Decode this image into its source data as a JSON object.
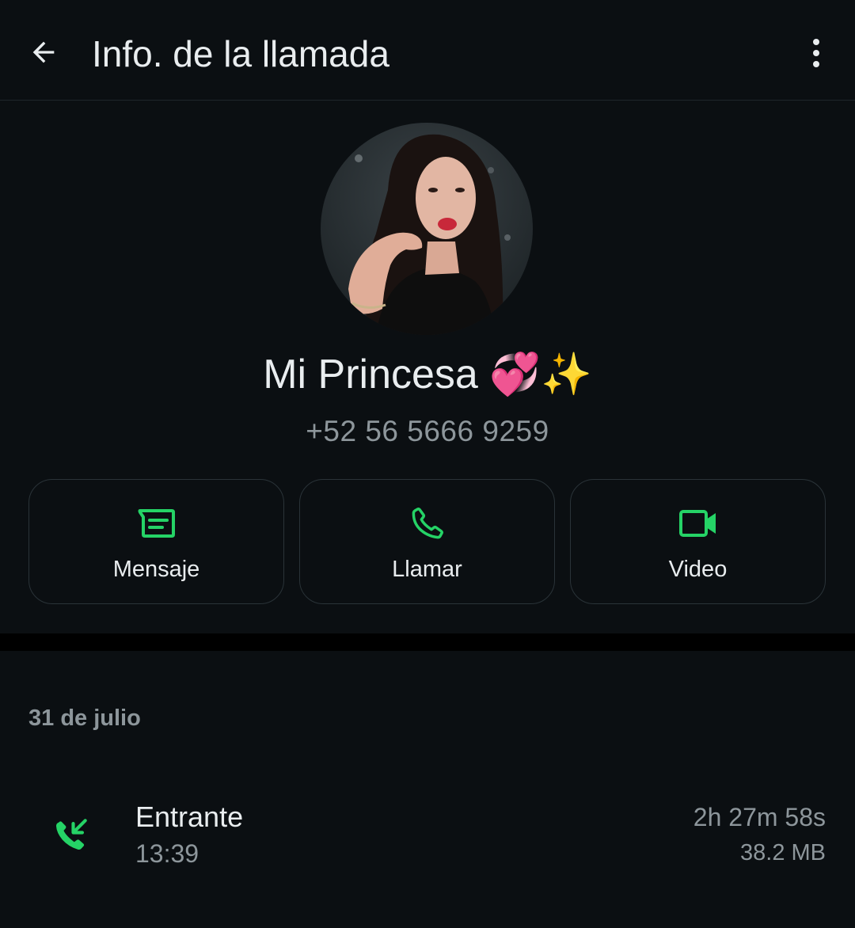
{
  "header": {
    "title": "Info. de la llamada",
    "back_icon": "arrow-left-icon",
    "menu_icon": "more-vertical-icon"
  },
  "contact": {
    "name": "Mi Princesa",
    "name_emoji": "💞✨",
    "phone": "+52 56 5666 9259",
    "avatar": "profile-photo"
  },
  "actions": [
    {
      "label": "Mensaje",
      "icon": "message-icon"
    },
    {
      "label": "Llamar",
      "icon": "phone-icon"
    },
    {
      "label": "Video",
      "icon": "video-camera-icon"
    }
  ],
  "history": {
    "date": "31 de julio",
    "calls": [
      {
        "type": "Entrante",
        "time": "13:39",
        "duration": "2h 27m 58s",
        "size": "38.2 MB",
        "icon": "incoming-call-icon"
      }
    ]
  },
  "colors": {
    "background": "#0b0f12",
    "accent": "#25d366",
    "text_primary": "#e9edef",
    "text_secondary": "#8d969b"
  }
}
